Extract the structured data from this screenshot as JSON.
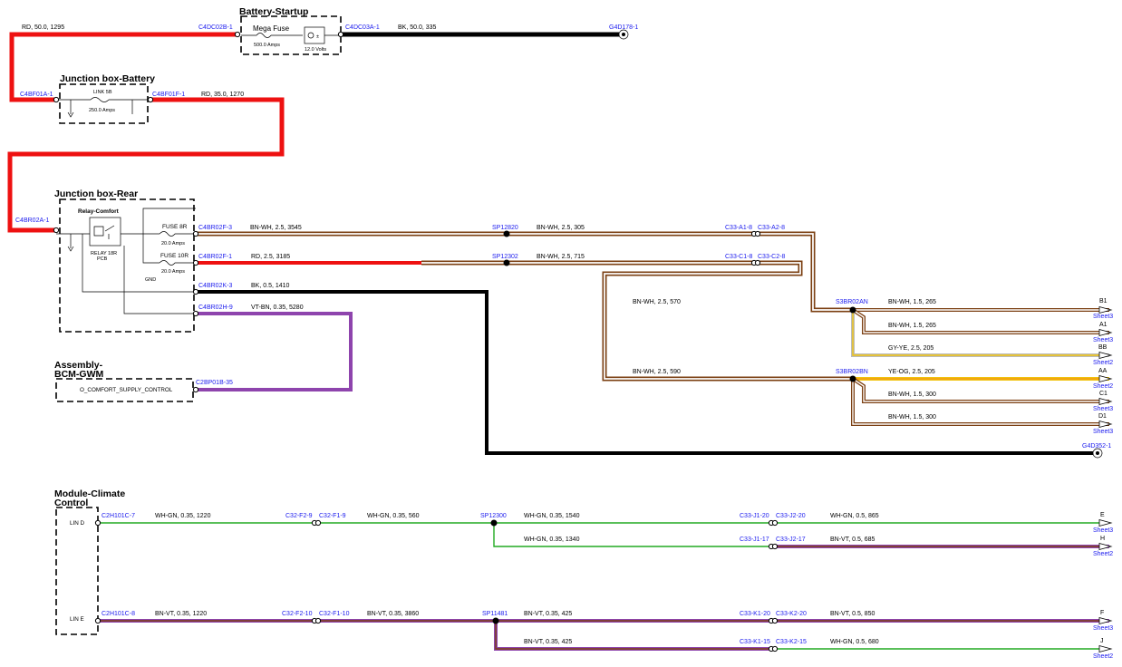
{
  "colors": {
    "red": "#ee1111",
    "black": "#000000",
    "brown": "#7b3f12",
    "white": "#ffffff",
    "violet": "#8e44ad",
    "green": "#22aa22",
    "yellow": "#f1c40f",
    "gray": "#bbbbbb",
    "orange": "#f39c12",
    "connector_text": "#1a1aee"
  },
  "components": {
    "battery_startup": {
      "title": "Battery-Startup",
      "fuse_name": "Mega Fuse",
      "fuse_rating": "500.0 Amps",
      "battery_rating": "12.0 Volts"
    },
    "junction_box_battery": {
      "title": "Junction box-Battery",
      "link_name": "LINK 5B",
      "link_rating": "250.0 Amps"
    },
    "junction_box_rear": {
      "title": "Junction box-Rear",
      "relay_name": "Relay-Comfort",
      "relay_sub": "RELAY 18R",
      "relay_sub2": "PCB",
      "fuse_a_name": "FUSE 8R",
      "fuse_a_rating": "20.0 Amps",
      "fuse_b_name": "FUSE 10R",
      "fuse_b_rating": "20.0 Amps",
      "gnd_label": "GND"
    },
    "bcm": {
      "title_line1": "Assembly-",
      "title_line2": "BCM-GWM",
      "signal": "O_COMFORT_SUPPLY_CONTROL"
    },
    "climate": {
      "title_line1": "Module-Climate",
      "title_line2": "Control",
      "pin_d": "LIN D",
      "pin_e": "LIN E"
    }
  },
  "connectors": {
    "c4dc02b": "C4DC02B-1",
    "c4dc03a": "C4DC03A-1",
    "g4d178": "G4D178-1",
    "c4bf01a": "C4BF01A-1",
    "c4bf01f": "C4BF01F-1",
    "c4br02a": "C4BR02A-1",
    "c4br02f3": "C4BR02F-3",
    "c4br02f1": "C4BR02F-1",
    "c4br02k": "C4BR02K-3",
    "c4br02h": "C4BR02H-9",
    "c2bp01b": "C2BP01B-35",
    "sp12820": "SP12820",
    "sp12302": "SP12302",
    "c33a1": "C33-A1-8",
    "c33a2": "C33-A2-8",
    "c33c1": "C33-C1-8",
    "c33c2": "C33-C2-8",
    "s3br02an": "S3BR02AN",
    "s3br02bn": "S3BR02BN",
    "g4d352": "G4D352-1",
    "c2h101c7": "C2H101C-7",
    "c32f2_9": "C32-F2-9",
    "c32f1_9": "C32-F1-9",
    "sp12300": "SP12300",
    "c33j1_20": "C33-J1-20",
    "c33j2_20": "C33-J2-20",
    "c33j1_17": "C33-J1-17",
    "c33j2_17": "C33-J2-17",
    "c2h101c8": "C2H101C-8",
    "c32f2_10": "C32-F2-10",
    "c32f1_10": "C32-F1-10",
    "sp11481": "SP11481",
    "c33k1_20": "C33-K1-20",
    "c33k2_20": "C33-K2-20",
    "c33k1_15": "C33-K1-15",
    "c33k2_15": "C33-K2-15"
  },
  "wires": {
    "w_rd_1295": "RD,  50.0,  1295",
    "w_bk_335": "BK,  50.0,  335",
    "w_rd_1270": "RD,  35.0,  1270",
    "w_bnwh_3545": "BN-WH,  2.5,  3545",
    "w_bnwh_305": "BN-WH,  2.5,  305",
    "w_rd_3185": "RD,  2.5,  3185",
    "w_bnwh_715": "BN-WH,  2.5,  715",
    "w_bk_1410": "BK,  0.5,  1410",
    "w_vtbn_5280": "VT-BN,  0.35,  5280",
    "w_bnwh_570": "BN-WH,  2.5,  570",
    "w_bnwh_265a": "BN-WH,  1.5,  265",
    "w_bnwh_265b": "BN-WH,  1.5,  265",
    "w_gyye_205": "GY-YE,  2.5,  205",
    "w_bnwh_590": "BN-WH,  2.5,  590",
    "w_yeog_205": "YE-OG,  2.5,  205",
    "w_bnwh_300a": "BN-WH,  1.5,  300",
    "w_bnwh_300b": "BN-WH,  1.5,  300",
    "w_whgn_1220": "WH-GN,  0.35,  1220",
    "w_whgn_560": "WH-GN,  0.35,  560",
    "w_whgn_1540": "WH-GN,  0.35,  1540",
    "w_whgn_865": "WH-GN,  0.5,  865",
    "w_whgn_1340": "WH-GN,  0.35,  1340",
    "w_bnvt_685": "BN-VT,  0.5,  685",
    "w_bnvt_1220": "BN-VT,  0.35,  1220",
    "w_bnvt_3860": "BN-VT,  0.35,  3860",
    "w_bnvt_425a": "BN-VT,  0.35,  425",
    "w_bnvt_850": "BN-VT,  0.5,  850",
    "w_bnvt_425b": "BN-VT,  0.35,  425",
    "w_whgn_680": "WH-GN,  0.5,  680"
  },
  "offsheet": [
    {
      "id": "B1",
      "sheet": "Sheet3"
    },
    {
      "id": "A1",
      "sheet": "Sheet3"
    },
    {
      "id": "BB",
      "sheet": "Sheet2"
    },
    {
      "id": "AA",
      "sheet": "Sheet2"
    },
    {
      "id": "C1",
      "sheet": "Sheet3"
    },
    {
      "id": "D1",
      "sheet": "Sheet3"
    },
    {
      "id": "E",
      "sheet": "Sheet3"
    },
    {
      "id": "H",
      "sheet": "Sheet2"
    },
    {
      "id": "F",
      "sheet": "Sheet3"
    },
    {
      "id": "J",
      "sheet": "Sheet2"
    }
  ]
}
